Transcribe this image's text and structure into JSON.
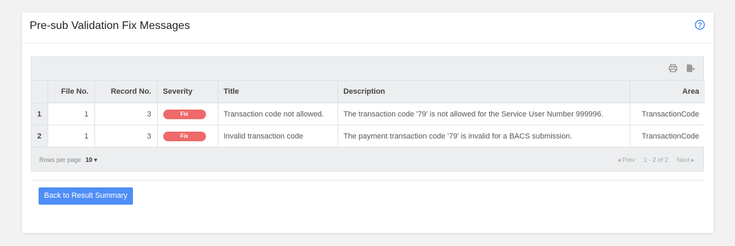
{
  "header": {
    "title": "Pre-sub Validation Fix Messages"
  },
  "icons": {
    "help": "help-circle-icon",
    "print": "printer-icon",
    "export": "export-icon"
  },
  "colors": {
    "accent": "#4f8ef7",
    "severity_fix": "#ef6a6a"
  },
  "table": {
    "columns": [
      "File No.",
      "Record No.",
      "Severity",
      "Title",
      "Description",
      "Area"
    ],
    "rows": [
      {
        "index": "1",
        "file_no": "1",
        "record_no": "3",
        "severity": "Fix",
        "title": "Transaction code not allowed.",
        "description": "The transaction code '79' is not allowed for the Service User Number 999996.",
        "area": "TransactionCode"
      },
      {
        "index": "2",
        "file_no": "1",
        "record_no": "3",
        "severity": "Fix",
        "title": "Invalid transaction code",
        "description": "The payment transaction code '79' is invalid for a BACS submission.",
        "area": "TransactionCode"
      }
    ]
  },
  "pagination": {
    "rows_per_page_label": "Rows per page",
    "rows_per_page_value": "10 ▾",
    "prev_label": "◂ Prev",
    "range": "1 - 2 of 2",
    "next_label": "Next ▸"
  },
  "actions": {
    "back_label": "Back to Result Summary"
  }
}
